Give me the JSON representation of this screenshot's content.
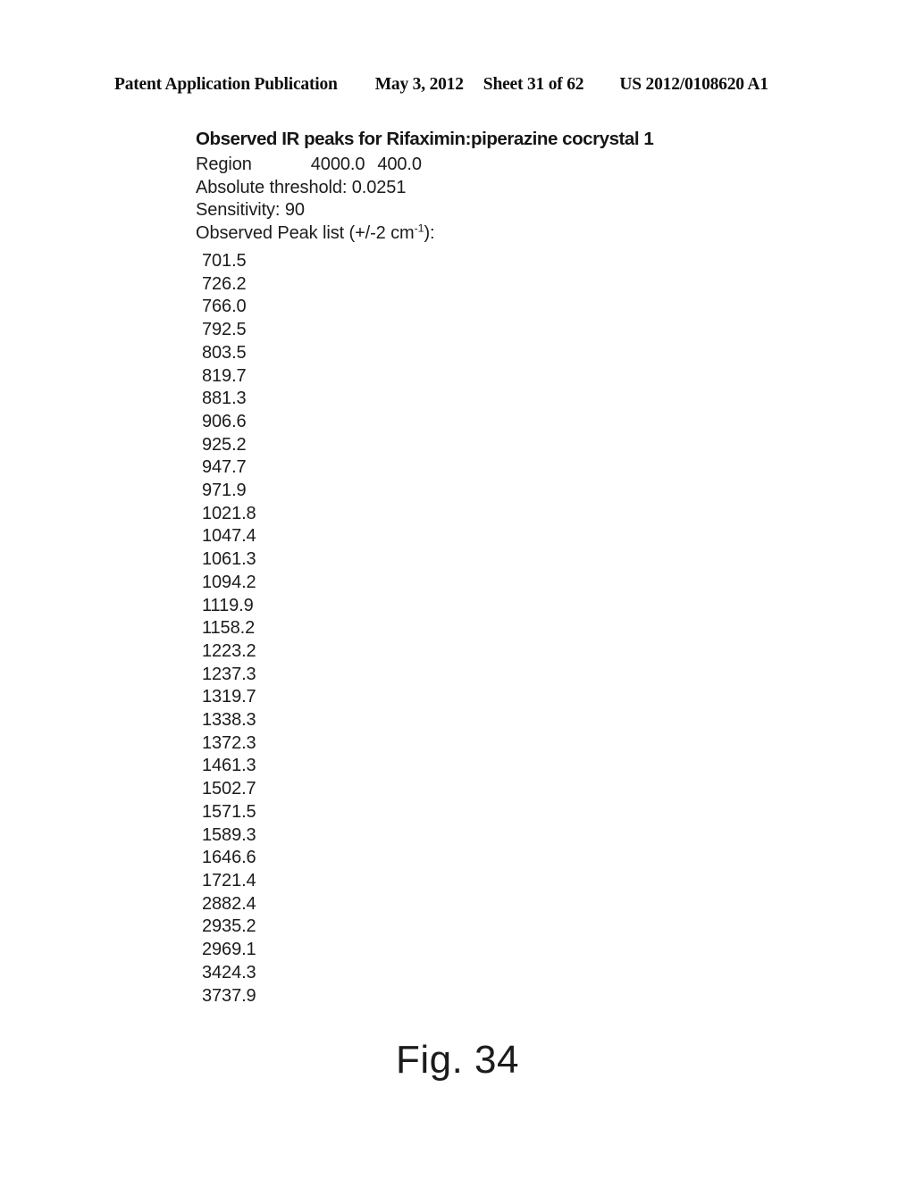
{
  "page_header": {
    "publication_label": "Patent Application Publication",
    "publication_date": "May 3, 2012",
    "sheet_label": "Sheet 31 of 62",
    "document_number": "US 2012/0108620 A1"
  },
  "figure": {
    "title": "Observed IR peaks for Rifaximin:piperazine cocrystal 1",
    "caption": "Fig. 34",
    "parameters": {
      "region_label": "Region",
      "region_start": "4000.0",
      "region_end": "400.0",
      "threshold_line": "Absolute threshold: 0.0251",
      "sensitivity_line": "Sensitivity: 90",
      "peak_list_label_pre": "Observed Peak list (+/-2 cm",
      "peak_list_label_sup": "-1",
      "peak_list_label_post": "):"
    },
    "peaks": [
      "701.5",
      "726.2",
      "766.0",
      "792.5",
      "803.5",
      "819.7",
      "881.3",
      "906.6",
      "925.2",
      "947.7",
      "971.9",
      "1021.8",
      "1047.4",
      "1061.3",
      "1094.2",
      "1119.9",
      "1158.2",
      "1223.2",
      "1237.3",
      "1319.7",
      "1338.3",
      "1372.3",
      "1461.3",
      "1502.7",
      "1571.5",
      "1589.3",
      "1646.6",
      "1721.4",
      "2882.4",
      "2935.2",
      "2969.1",
      "3424.3",
      "3737.9"
    ]
  }
}
